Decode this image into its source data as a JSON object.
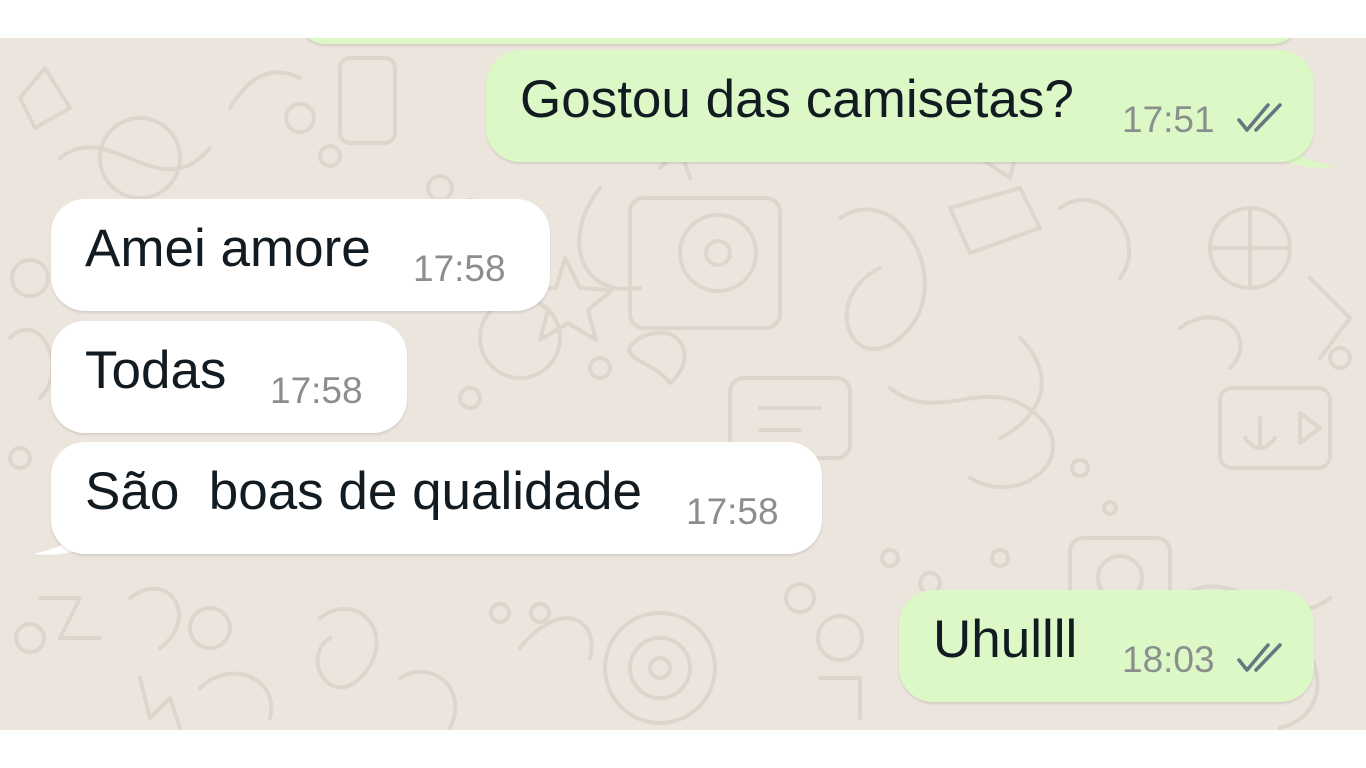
{
  "messages": [
    {
      "direction": "outgoing",
      "text": "Gostou das camisetas?",
      "time": "17:51",
      "status_icon": "double-check-icon"
    },
    {
      "direction": "incoming",
      "text": "Amei amore",
      "time": "17:58"
    },
    {
      "direction": "incoming",
      "text": "Todas",
      "time": "17:58"
    },
    {
      "direction": "incoming",
      "text": "São  boas de qualidade",
      "time": "17:58"
    },
    {
      "direction": "outgoing",
      "text": "Uhullll",
      "time": "18:03",
      "status_icon": "double-check-icon"
    }
  ],
  "colors": {
    "outgoing_bubble": "#dcf8c6",
    "incoming_bubble": "#ffffff",
    "background": "#ece5dd",
    "time_text": "#8a8f8d",
    "message_text": "#111b21"
  }
}
